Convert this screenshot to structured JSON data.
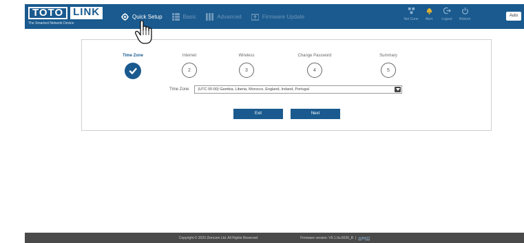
{
  "header": {
    "logo": {
      "brand_left": "TOTO",
      "brand_right": "LINK",
      "slogan": "The Smartest Network Device"
    },
    "nav": [
      {
        "label": "Quick Setup",
        "icon": "gear-icon",
        "active": true
      },
      {
        "label": "Basic",
        "icon": "grid-icon",
        "active": false
      },
      {
        "label": "Advanced",
        "icon": "bars-icon",
        "active": false
      },
      {
        "label": "Firmware Update",
        "icon": "upload-icon",
        "active": false
      }
    ],
    "tools": [
      {
        "label": "Net Conn",
        "icon": "network-icon"
      },
      {
        "label": "Alert",
        "icon": "bell-icon"
      },
      {
        "label": "Logout",
        "icon": "logout-icon"
      },
      {
        "label": "Reboot",
        "icon": "power-icon"
      }
    ],
    "language": "Auto"
  },
  "wizard": {
    "steps": [
      {
        "label": "Time Zone",
        "number": "1",
        "done": true
      },
      {
        "label": "Internet",
        "number": "2",
        "done": false
      },
      {
        "label": "Wireless",
        "number": "3",
        "done": false
      },
      {
        "label": "Change Password",
        "number": "4",
        "done": false
      },
      {
        "label": "Summary",
        "number": "5",
        "done": false
      }
    ],
    "timezone": {
      "label": "Time Zone",
      "value": "(UTC 00:00) Gambia, Liberia, Morocco, England, Ireland, Portugal"
    },
    "buttons": {
      "exit": "Exit",
      "next": "Next"
    }
  },
  "footer": {
    "copyright": "Copyright © 2020 Zioncom Ltd. All Rights Reserved",
    "firmware": "Firmware version: V9.1.0u.6026_B",
    "separator": "|",
    "support": "support"
  },
  "colors": {
    "brand_blue": "#1a5a8e",
    "footer_gray": "#4a4a4a",
    "alert_yellow": "#e0b030"
  }
}
